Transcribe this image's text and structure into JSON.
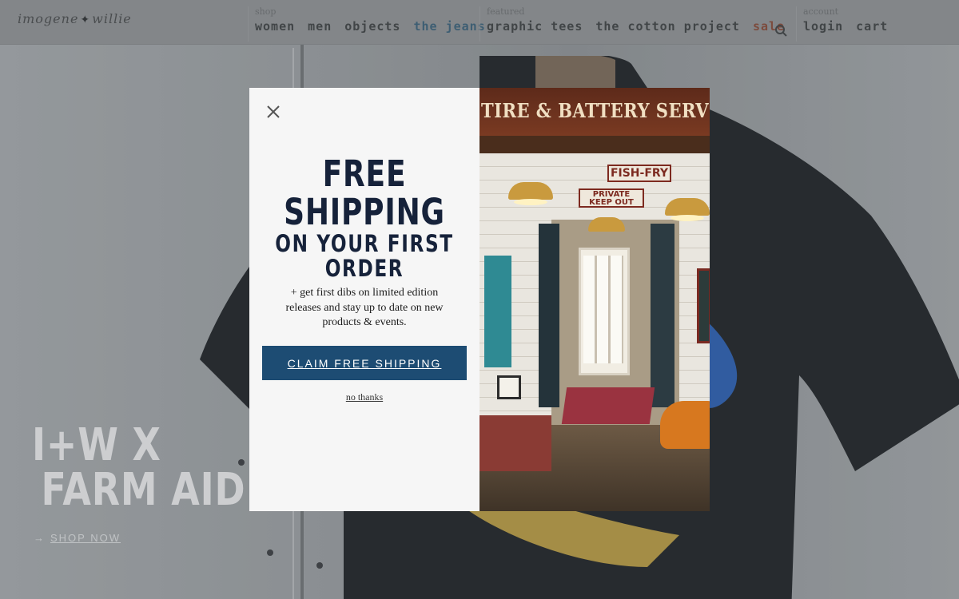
{
  "header": {
    "logo_text_left": "imogene",
    "logo_text_right": "willie",
    "shop": {
      "caption": "shop",
      "links": [
        "women",
        "men",
        "objects",
        "the jeans"
      ]
    },
    "featured": {
      "caption": "featured",
      "links": [
        "graphic tees",
        "the cotton project",
        "sale"
      ]
    },
    "account": {
      "caption": "account",
      "links": [
        "login",
        "cart"
      ]
    }
  },
  "hero": {
    "title_line1": "I+W X",
    "title_line2": "FARM AID",
    "cta_arrow": "→",
    "cta_label": "SHOP NOW"
  },
  "modal": {
    "close_glyph": "×",
    "headline_line1": "FREE",
    "headline_line2": "SHIPPING",
    "headline_line3": "ON YOUR FIRST",
    "headline_line4": "ORDER",
    "subtext": "+ get first dibs on limited edition releases and stay up to date on new products & events.",
    "cta_label": "CLAIM FREE SHIPPING",
    "dismiss_label": "no thanks",
    "image": {
      "sign_main": "TIRE & BATTERY SERVICE",
      "sign_fish": "FISH-FRY",
      "sign_private_1": "PRIVATE",
      "sign_private_2": "KEEP OUT"
    }
  },
  "colors": {
    "cta_bg": "#1d4c73",
    "headline": "#16223a",
    "nav_highlight": "#3b6179",
    "nav_sale": "#874a38"
  }
}
